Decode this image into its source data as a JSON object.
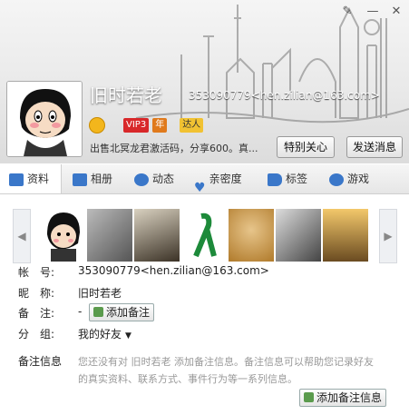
{
  "profile": {
    "name": "旧时若老",
    "qq_email": "353090779<hen.zilian@163.com>",
    "signature": "出售北冥龙君激活码，分享600。真...",
    "badges": {
      "vip_label": "VIP3",
      "year_label": "年",
      "daren_label": "达人"
    }
  },
  "actions": {
    "special_care": "特别关心",
    "send_message": "发送消息"
  },
  "tabs": [
    {
      "label": "资料"
    },
    {
      "label": "相册"
    },
    {
      "label": "动态"
    },
    {
      "label": "亲密度"
    },
    {
      "label": "标签"
    },
    {
      "label": "游戏"
    }
  ],
  "fields": {
    "account_label": "帐　号:",
    "account_value": "353090779<hen.zilian@163.com>",
    "nickname_label": "昵　称:",
    "nickname_value": "旧时若老",
    "remark_label": "备　注:",
    "remark_value": "-",
    "add_remark": "添加备注",
    "group_label": "分　组:",
    "group_value": "我的好友",
    "remark_info_label": "备注信息",
    "remark_info_text": "您还没有对 旧时若老 添加备注信息。备注信息可以帮助您记录好友的真实资料、联系方式、事件行为等一系列信息。",
    "add_remark_info": "添加备注信息"
  },
  "colors": {
    "tab_active": "#ffffff",
    "accent": "#1a6fc9",
    "remark_text": "#999999"
  }
}
